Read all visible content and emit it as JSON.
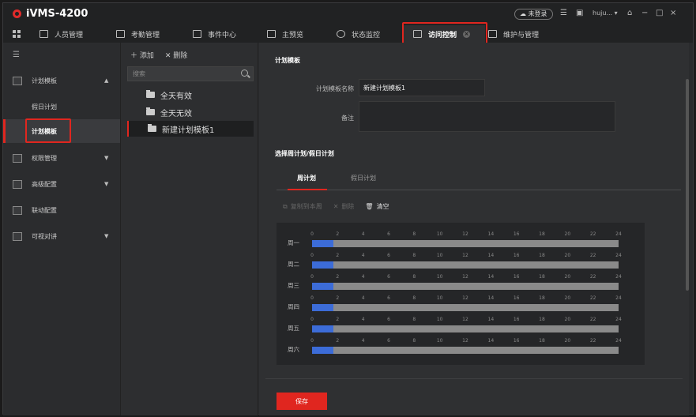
{
  "app": {
    "title": "iVMS-4200",
    "login_status": "未登录",
    "user": "huju...",
    "window_controls": [
      "−",
      "□",
      "×"
    ]
  },
  "topnav": {
    "items": [
      {
        "label": "人员管理",
        "icon": "person-card-icon"
      },
      {
        "label": "考勤管理",
        "icon": "calendar-icon"
      },
      {
        "label": "事件中心",
        "icon": "bell-icon"
      },
      {
        "label": "主预览",
        "icon": "monitor-icon"
      },
      {
        "label": "状态监控",
        "icon": "circle-icon"
      },
      {
        "label": "访问控制",
        "icon": "door-icon",
        "active": true
      },
      {
        "label": "维护与管理",
        "icon": "document-icon"
      }
    ]
  },
  "sidebar": {
    "items": [
      {
        "label": "计划模板",
        "expanded": true
      },
      {
        "label": "假日计划"
      },
      {
        "label": "计划模板",
        "selected": true
      },
      {
        "label": "权限管理"
      },
      {
        "label": "高级配置"
      },
      {
        "label": "联动配置"
      },
      {
        "label": "可视对讲"
      }
    ]
  },
  "tree": {
    "add_label": "添加",
    "delete_label": "删除",
    "search_placeholder": "搜索",
    "items": [
      "全天有效",
      "全天无效",
      "新建计划模板1"
    ]
  },
  "main": {
    "section_title": "计划模板",
    "name_label": "计划模板名称",
    "name_value": "新建计划模板1",
    "remark_label": "备注",
    "remark_value": "",
    "schedule_title": "选择周计划/假日计划",
    "tabs": [
      "周计划",
      "假日计划"
    ],
    "toolbar": {
      "copy": "复制到本周",
      "delete": "删除",
      "clear": "清空"
    },
    "save_label": "保存"
  },
  "schedule": {
    "ticks": [
      "0",
      "2",
      "4",
      "6",
      "8",
      "10",
      "12",
      "14",
      "16",
      "18",
      "20",
      "22",
      "24"
    ],
    "days": [
      {
        "label": "周一",
        "fill_fraction": 0.07
      },
      {
        "label": "周二",
        "fill_fraction": 0.07
      },
      {
        "label": "周三",
        "fill_fraction": 0.07
      },
      {
        "label": "周四",
        "fill_fraction": 0.07
      },
      {
        "label": "周五",
        "fill_fraction": 0.07
      },
      {
        "label": "周六",
        "fill_fraction": 0.07
      }
    ]
  },
  "colors": {
    "accent": "#e0261f",
    "schedule_fill": "#3c6cd8"
  }
}
